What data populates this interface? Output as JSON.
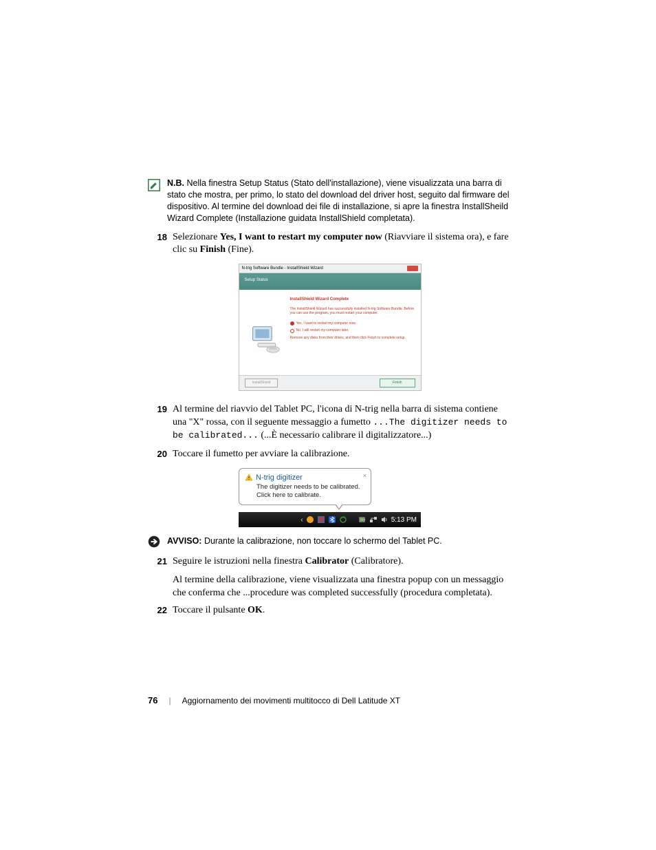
{
  "note": {
    "label": "N.B.",
    "text": " Nella finestra Setup Status (Stato dell'installazione), viene visualizzata una barra di stato che mostra, per primo, lo stato del download del driver host, seguito dal firmware del dispositivo. Al termine del download dei file di installazione, si apre la finestra InstallSheild Wizard Complete (Installazione guidata InstallShield completata)."
  },
  "step18": {
    "num": "18",
    "t1": "Selezionare ",
    "b1": "Yes, I want to restart my computer now",
    "t2": " (Riavviare il sistema ora), e fare clic su ",
    "b2": "Finish",
    "t3": " (Fine)."
  },
  "wizard": {
    "title": "N-trig Software Bundle - InstallShield Wizard",
    "banner": "Setup Status",
    "heading": "InstallShield Wizard Complete",
    "text": "The InstallShield Wizard has successfully installed N-trig Software Bundle. Before you can use the program, you must restart your computer.",
    "opt1": "Yes, I want to restart my computer now.",
    "opt2": "No, I will restart my computer later.",
    "foot": "Remove any disks from their drives, and then click Finish to complete setup.",
    "btn_back": "InstallShield",
    "btn_finish": "Finish"
  },
  "step19": {
    "num": "19",
    "t1": "Al termine del riavvio del Tablet PC, l'icona di N-trig nella barra di sistema contiene una \"X\" rossa, con il seguente messaggio a fumetto ",
    "code1": "...The digitizer needs to be calibrated...",
    "t2": " (...È necessario calibrare il digitalizzatore...)"
  },
  "step20": {
    "num": "20",
    "t1": "Toccare il fumetto per avviare la calibrazione."
  },
  "balloon": {
    "title": "N-trig digitizer",
    "line1": "The digitizer needs to be calibrated.",
    "line2": "Click here to calibrate."
  },
  "taskbar": {
    "time": "5:13 PM"
  },
  "avviso": {
    "label": "AVVISO:",
    "text": " Durante la calibrazione, non toccare lo schermo del Tablet PC."
  },
  "step21": {
    "num": "21",
    "t1": "Seguire le istruzioni nella finestra ",
    "b1": "Calibrator",
    "t2": " (Calibratore)."
  },
  "step21b": {
    "t1": "Al termine della calibrazione, viene visualizzata una finestra popup con un messaggio che conferma che ",
    "code": "...procedure was completed successfully",
    "t2": " (procedura completata)."
  },
  "step22": {
    "num": "22",
    "t1": "Toccare il pulsante ",
    "b1": "OK",
    "t2": "."
  },
  "footer": {
    "page": "76",
    "title": "Aggiornamento dei movimenti multitocco di Dell Latitude XT"
  }
}
